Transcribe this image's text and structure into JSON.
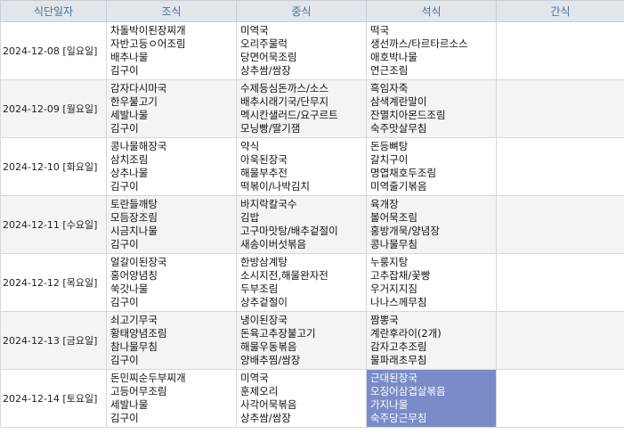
{
  "headers": {
    "date": "식단일자",
    "breakfast": "조식",
    "lunch": "중식",
    "dinner": "석식",
    "snack": "간식"
  },
  "days": [
    {
      "date": "2024-12-08 [일요일]",
      "breakfast": [
        "차돌박이된장찌개",
        "자반고등ㅇ어조림",
        "배추나물",
        "김구이"
      ],
      "lunch": [
        "미역국",
        "오리주물럭",
        "당면어묵조림",
        "상추쌈/쌈장"
      ],
      "dinner": [
        "떡국",
        "생선까스/타르타르소스",
        "애호박나물",
        "연근조림"
      ],
      "snack": []
    },
    {
      "date": "2024-12-09 [월요일]",
      "breakfast": [
        "감자다시마국",
        "한우불고기",
        "세발나물",
        "김구이"
      ],
      "lunch": [
        "수제등심돈까스/소스",
        "배추시래기국/단무지",
        "멕시칸샐러드/요구르트",
        "모닝빵/딸기잼"
      ],
      "dinner": [
        "흑임자죽",
        "삼색계란말이",
        "잔멸치아몬드조림",
        "숙주맛살무침"
      ],
      "snack": []
    },
    {
      "date": "2024-12-10 [화요일]",
      "breakfast": [
        "콩나물해장국",
        "삼치조림",
        "상추나물",
        "김구이"
      ],
      "lunch": [
        "약식",
        "아욱된장국",
        "해물부추전",
        "떡볶이/나박김치"
      ],
      "dinner": [
        "돈등뼈탕",
        "갈치구이",
        "명엽채호두조림",
        "미역줄기볶음"
      ],
      "snack": []
    },
    {
      "date": "2024-12-11 [수요일]",
      "breakfast": [
        "토란들깨탕",
        "모듬장조림",
        "시금치나물",
        "김구이"
      ],
      "lunch": [
        "바지락칼국수",
        "김밥",
        "고구마맛탕/배추겉절이",
        "새송이버섯볶음"
      ],
      "dinner": [
        "육개장",
        "볼어묵조림",
        "홍방개묵/양념장",
        "콩나물무침"
      ],
      "snack": []
    },
    {
      "date": "2024-12-12 [목요일]",
      "breakfast": [
        "얼갈이된장국",
        "홍어양념칭",
        "쑥갓나물",
        "김구이"
      ],
      "lunch": [
        "한방삼계탕",
        "소시지전,해물완자전",
        "두부조림",
        "상추겉절이"
      ],
      "dinner": [
        "누룽지탕",
        "고추잡채/꽃빵",
        "우거지지짐",
        "나나스께무침"
      ],
      "snack": []
    },
    {
      "date": "2024-12-13 [금요일]",
      "breakfast": [
        "쇠고기무국",
        "황태양념조림",
        "참나물무침",
        "김구이"
      ],
      "lunch": [
        "냉이된장국",
        "돈육고추장불고기",
        "해물우동볶음",
        "양배추찜/쌈장"
      ],
      "dinner": [
        "짬뽕국",
        "계란후라이(2개)",
        "감자고추조림",
        "물파래초무침"
      ],
      "snack": []
    },
    {
      "date": "2024-12-14 [토요일]",
      "breakfast": [
        "돈민찌순두부찌개",
        "고등어무조림",
        "세발나물",
        "김구이"
      ],
      "lunch": [
        "미역국",
        "훈제오리",
        "사각어묵볶음",
        "상추쌈/쌈장"
      ],
      "dinner": [
        "근대된장국",
        "오징어삼겹살볶음",
        "가지나물",
        "숙주당근무침"
      ],
      "snack": []
    }
  ],
  "colors": {
    "header_bg": "#e2e5ea",
    "header_text": "#4a6f9a",
    "selected_bg": "#7a8cc8",
    "selected_text": "#ffffff"
  }
}
